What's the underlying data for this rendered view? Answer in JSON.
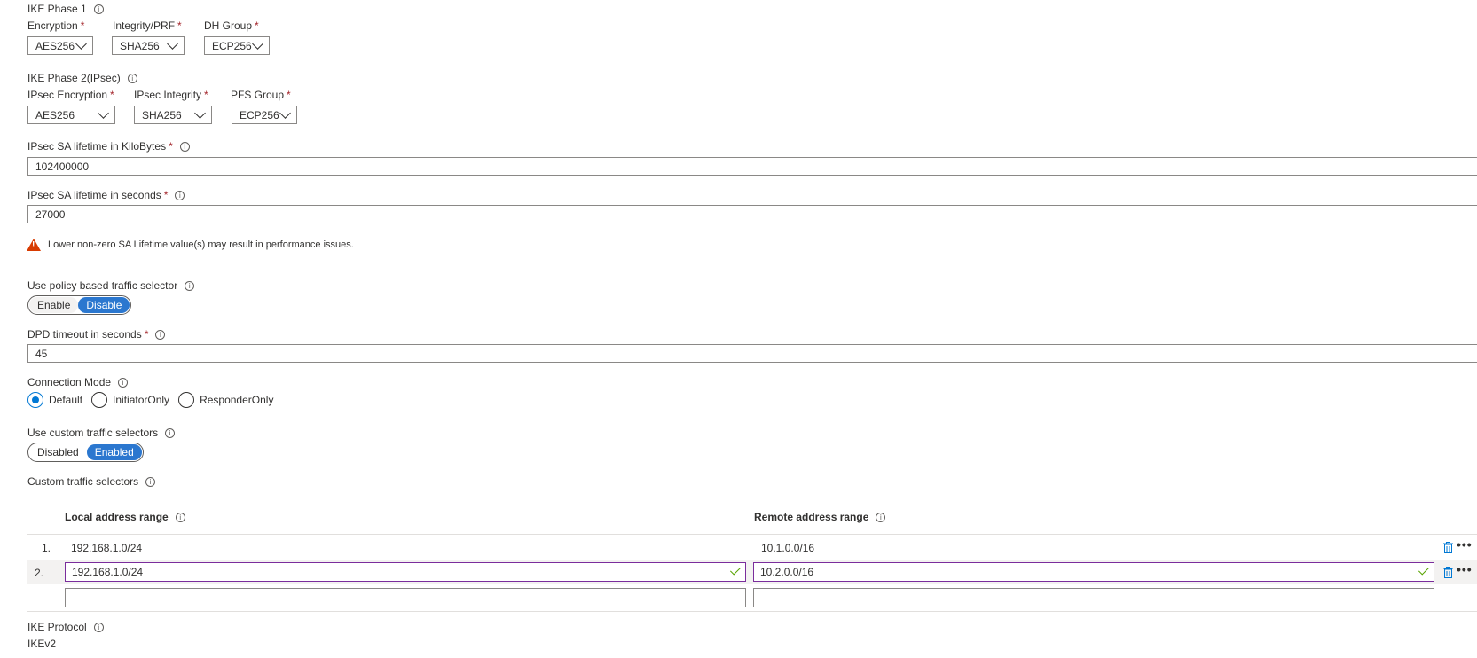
{
  "ike_phase1": {
    "title": "IKE Phase 1",
    "fields": [
      {
        "label": "Encryption",
        "value": "AES256"
      },
      {
        "label": "Integrity/PRF",
        "value": "SHA256"
      },
      {
        "label": "DH Group",
        "value": "ECP256"
      }
    ]
  },
  "ike_phase2": {
    "title": "IKE Phase 2(IPsec)",
    "fields": [
      {
        "label": "IPsec Encryption",
        "value": "AES256"
      },
      {
        "label": "IPsec Integrity",
        "value": "SHA256"
      },
      {
        "label": "PFS Group",
        "value": "ECP256"
      }
    ]
  },
  "required_mark": "*",
  "info_glyph": "i",
  "sa_kilobytes": {
    "label": "IPsec SA lifetime in KiloBytes",
    "value": "102400000"
  },
  "sa_seconds": {
    "label": "IPsec SA lifetime in seconds",
    "value": "27000"
  },
  "warning": {
    "icon": "warning-triangle-icon",
    "glyph": "!",
    "text": "Lower non-zero SA Lifetime value(s) may result in performance issues.",
    "color": "#d83b01"
  },
  "policy_selector": {
    "label": "Use policy based traffic selector",
    "options": [
      "Enable",
      "Disable"
    ],
    "selected": "Disable"
  },
  "dpd": {
    "label": "DPD timeout in seconds",
    "value": "45"
  },
  "connection_mode": {
    "label": "Connection Mode",
    "options": [
      "Default",
      "InitiatorOnly",
      "ResponderOnly"
    ],
    "selected": "Default"
  },
  "custom_selectors_toggle": {
    "label": "Use custom traffic selectors",
    "options": [
      "Disabled",
      "Enabled"
    ],
    "selected": "Enabled"
  },
  "custom_selectors": {
    "label": "Custom traffic selectors",
    "columns": [
      "Local address range",
      "Remote address range"
    ],
    "rows": [
      {
        "index": "1.",
        "local": "192.168.1.0/24",
        "remote": "10.1.0.0/16"
      },
      {
        "index": "2.",
        "local": "192.168.1.0/24",
        "remote": "10.2.0.0/16"
      }
    ],
    "new_row": {
      "local": "",
      "remote": ""
    },
    "more_glyph": "•••"
  },
  "ike_protocol": {
    "label": "IKE Protocol",
    "value": "IKEv2"
  },
  "colors": {
    "accent": "#2b77cf",
    "required": "#a4262c",
    "valid_border": "#7a2d9c",
    "valid_check": "#57a300"
  }
}
